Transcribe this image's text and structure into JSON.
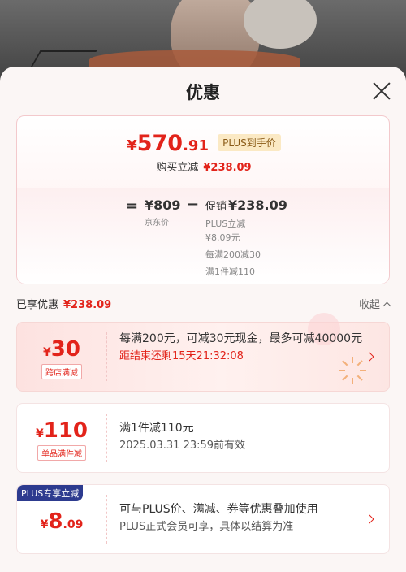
{
  "title": "优惠",
  "price": {
    "symbol": "¥",
    "integer": "570",
    "decimal": ".91",
    "badge": "PLUS到手价",
    "buy_label": "购买立减",
    "buy_amount": "¥238.09"
  },
  "breakdown": {
    "equals": "=",
    "jd_price": "¥809",
    "jd_label": "京东价",
    "minus": "−",
    "promo_label": "促销",
    "promo_amount": "¥238.09",
    "lines": [
      "PLUS立减",
      "¥8.09元",
      "每满200减30",
      "满1件减110"
    ]
  },
  "enjoyed": {
    "label": "已享优惠",
    "amount": "¥238.09",
    "collapse_label": "收起"
  },
  "coupons": [
    {
      "symbol": "¥",
      "amount": "30",
      "decimal": "",
      "tag": "跨店满减",
      "line1": "每满200元，可减30元现金，最多可减40000元",
      "line2": "距结束还剩15天21:32:08",
      "has_arrow": true
    },
    {
      "symbol": "¥",
      "amount": "110",
      "decimal": "",
      "tag": "单品满件减",
      "line1": "满1件减110元",
      "line2": "2025.03.31 23:59前有效",
      "has_arrow": false
    },
    {
      "symbol": "¥",
      "amount": "8",
      "decimal": ".09",
      "tag": "PLUS专享立减",
      "line1": "可与PLUS价、满减、券等优惠叠加使用",
      "line2": "PLUS正式会员可享，具体以结算为准",
      "has_arrow": true
    }
  ],
  "colors": {
    "accent_red": "#e2231a",
    "plus_blue": "#2d3b8f",
    "plus_gold_bg": "#fbe9c4"
  },
  "icons": [
    "close-icon",
    "chevron-up-icon",
    "chevron-right-icon"
  ]
}
